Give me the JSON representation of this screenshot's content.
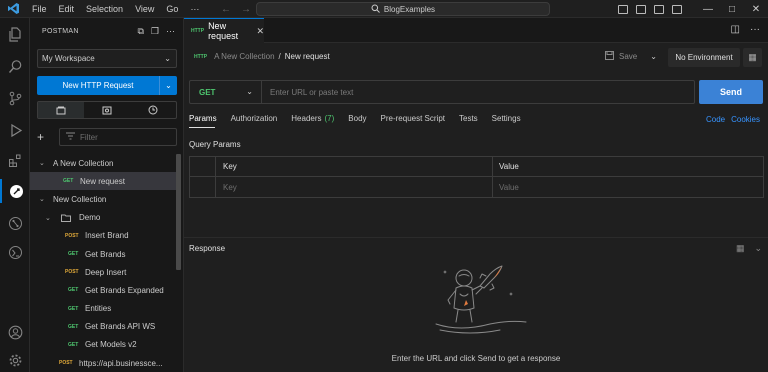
{
  "menu": [
    "File",
    "Edit",
    "Selection",
    "View",
    "Go"
  ],
  "menu_more": "···",
  "search_title": "BlogExamples",
  "sidebar": {
    "title": "POSTMAN",
    "workspace": "My Workspace",
    "new_request": "New HTTP Request",
    "filter_placeholder": "Filter",
    "tree": [
      {
        "type": "collection",
        "label": "A New Collection",
        "level": 0
      },
      {
        "type": "request",
        "method": "GET",
        "label": "New request",
        "level": 1,
        "selected": true
      },
      {
        "type": "collection",
        "label": "New Collection",
        "level": 0
      },
      {
        "type": "folder",
        "label": "Demo",
        "level": 1
      },
      {
        "type": "request",
        "method": "POST",
        "label": "Insert Brand",
        "level": 2
      },
      {
        "type": "request",
        "method": "GET",
        "label": "Get Brands",
        "level": 2
      },
      {
        "type": "request",
        "method": "POST",
        "label": "Deep Insert",
        "level": 2
      },
      {
        "type": "request",
        "method": "GET",
        "label": "Get Brands Expanded",
        "level": 2
      },
      {
        "type": "request",
        "method": "GET",
        "label": "Entities",
        "level": 2
      },
      {
        "type": "request",
        "method": "GET",
        "label": "Get Brands API WS",
        "level": 2
      },
      {
        "type": "request",
        "method": "GET",
        "label": "Get Models v2",
        "level": 2
      },
      {
        "type": "request",
        "method": "POST",
        "label": "https://api.businessce...",
        "level": 1
      }
    ]
  },
  "editor": {
    "tab_label": "New request",
    "tab_icon": "HTTP",
    "breadcrumb_collection": "A New Collection",
    "breadcrumb_sep": "/",
    "breadcrumb_request": "New request",
    "save_label": "Save",
    "environment": "No Environment",
    "method": "GET",
    "url_placeholder": "Enter URL or paste text",
    "send_label": "Send",
    "tabs": {
      "params": "Params",
      "authorization": "Authorization",
      "headers": "Headers",
      "headers_count": "(7)",
      "body": "Body",
      "prerequest": "Pre-request Script",
      "tests": "Tests",
      "settings": "Settings"
    },
    "code_link": "Code",
    "cookies_link": "Cookies",
    "query_params_title": "Query Params",
    "col_key": "Key",
    "col_value": "Value",
    "key_placeholder": "Key",
    "value_placeholder": "Value",
    "response_title": "Response",
    "response_message": "Enter the URL and click Send to get a response"
  },
  "colors": {
    "accent": "#0078d4",
    "send": "#3b82d6",
    "get": "#4ec66f",
    "post": "#e0a939",
    "link": "#3794ff"
  }
}
